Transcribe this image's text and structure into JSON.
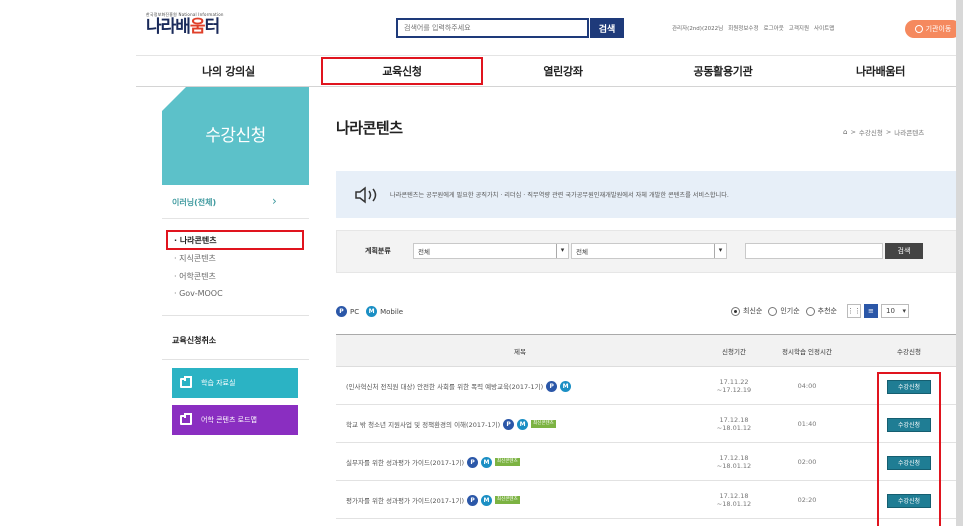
{
  "header": {
    "logo_small": "한국정보화진흥원 National Information",
    "logo_text_a": "나라배",
    "logo_text_b": "움",
    "logo_text_c": "터",
    "search_placeholder": "검색어를 입력하주세요",
    "search_button": "검색",
    "util_links": [
      "관리자(2nd)(2022님",
      "회원정보수정",
      "로그아웃",
      "고객지원",
      "사이트맵"
    ],
    "org_button": "기관이동"
  },
  "nav": {
    "items": [
      "나의 강의실",
      "교육신청",
      "열린강좌",
      "공동활용기관",
      "나라배움터"
    ]
  },
  "sidebar": {
    "title": "수강신청",
    "category": "이러닝(전체)",
    "category_arrow": "›",
    "subitems": [
      "· 나라콘텐츠",
      "· 지식콘텐츠",
      "· 어학콘텐츠",
      "· Gov-MOOC"
    ],
    "cancel_label": "교육신청취소",
    "buttons": [
      {
        "label": "학습 자료실",
        "color": "#2bb3c4"
      },
      {
        "label": "어학 콘텐츠 로드맵",
        "color": "#8a2ec1"
      }
    ]
  },
  "main": {
    "title": "나라콘텐츠",
    "breadcrumb": [
      "수강신청",
      "나라콘텐츠"
    ],
    "breadcrumb_sep": ">",
    "notice": "나라콘텐츠는 공무원에게 필요한 공직가치 · 리더십 · 직무역량 관련 국가공무원인재개발원에서 자체 개발한 콘텐츠를 서비스합니다.",
    "filter": {
      "label": "계획분류",
      "select1": "전체",
      "select2": "전체",
      "search_button": "검색"
    },
    "legend": {
      "pc": "PC",
      "mobile": "Mobile",
      "pc_badge": "P",
      "mobile_badge": "M"
    },
    "sort": {
      "options": [
        "최신순",
        "인기순",
        "추천순"
      ],
      "selected": "최신순",
      "page_size": "10"
    },
    "table": {
      "headers": [
        "제목",
        "신청기간",
        "정시학습 인정시간",
        "수강신청"
      ],
      "rows": [
        {
          "title": "(인사혁신처 전직원 대상) 안전한 사회를 위한 폭력 예방교육(2017-1기)",
          "period_start": "17.11.22",
          "period_end": "~17.12.19",
          "time": "04:00",
          "is_new": false,
          "apply": "수강신청"
        },
        {
          "title": "학교 밖 청소년 지원사업 및 정책환경의 이해(2017-1기)",
          "period_start": "17.12.18",
          "period_end": "~18.01.12",
          "time": "01:40",
          "is_new": true,
          "apply": "수강신청"
        },
        {
          "title": "실무자를 위한 성과평가 가이드(2017-1기)",
          "period_start": "17.12.18",
          "period_end": "~18.01.12",
          "time": "02:00",
          "is_new": true,
          "apply": "수강신청"
        },
        {
          "title": "평가자를 위한 성과평가 가이드(2017-1기)",
          "period_start": "17.12.18",
          "period_end": "~18.01.12",
          "time": "02:20",
          "is_new": true,
          "apply": "수강신청"
        }
      ],
      "new_label": "최신콘텐츠"
    }
  },
  "colors": {
    "navy": "#1e3a7a",
    "teal": "#5cc1c9",
    "highlight": "#e0141e",
    "apply": "#1f7d94"
  }
}
